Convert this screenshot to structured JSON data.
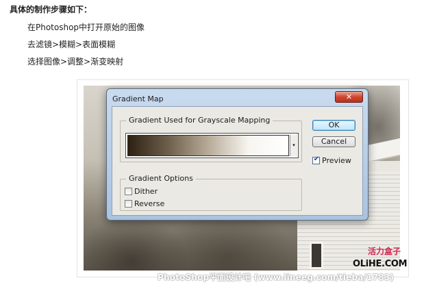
{
  "article": {
    "heading": "具体的制作步骤如下：",
    "steps": [
      "在Photoshop中打开原始的图像",
      "去滤镜>模糊>表面模糊",
      "选择图像>调整>渐变映射"
    ]
  },
  "dialog": {
    "title": "Gradient Map",
    "close_glyph": "✕",
    "gradient_group_label": "Gradient Used for Grayscale Mapping",
    "gradient_dropdown_glyph": "▾",
    "options_group_label": "Gradient Options",
    "dither_label": "Dither",
    "dither_checked": false,
    "reverse_label": "Reverse",
    "reverse_checked": false,
    "ok_label": "OK",
    "cancel_label": "Cancel",
    "preview_label": "Preview",
    "preview_checked": true,
    "check_glyph": "✔",
    "gradient_colors": [
      "#2d2114",
      "#6e5f4a",
      "#b7ab98",
      "#f7f5f0",
      "#ffffff"
    ]
  },
  "image_watermark": {
    "cn": "活力盒子",
    "site": "OLiHE.COM"
  },
  "footer_watermark": "PhotoShop平面设计吧 (www.lineeg.com/tieba/1783)",
  "icons": {
    "close": "close-icon",
    "dropdown": "chevron-down-icon",
    "check": "checkmark-icon"
  }
}
